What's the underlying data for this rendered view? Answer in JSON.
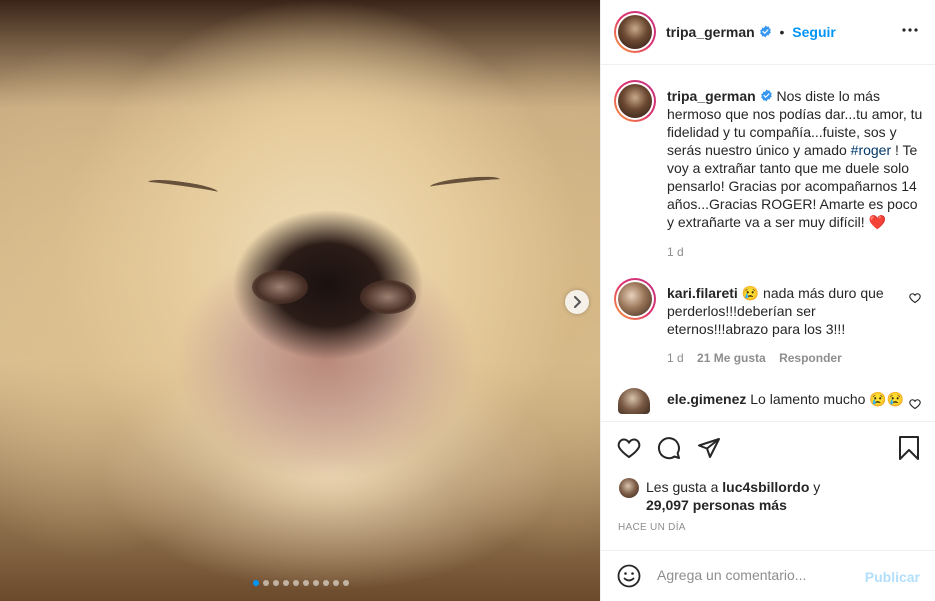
{
  "post": {
    "username": "tripa_german",
    "follow_label": "Seguir",
    "caption_pre": "Nos diste lo más hermoso que nos podías dar...tu amor, tu fidelidad y tu compañía...fuiste, sos y serás nuestro único y amado ",
    "caption_hashtag": "#roger",
    "caption_post": " ! Te voy a extrañar tanto que me duele solo pensarlo! Gracias por acompañarnos 14 años...Gracias ROGER! Amarte es poco y extrañarte va a ser muy difícil! ",
    "caption_emoji": "❤️",
    "caption_time": "1 d"
  },
  "carousel": {
    "slide_count": 10,
    "active_index": 0,
    "active_color": "#0095f6"
  },
  "comments": [
    {
      "username": "kari.filareti",
      "text": "😢 nada más duro que perderlos!!!deberían ser eternos!!!abrazo para los 3!!!",
      "time": "1 d",
      "likes": "21 Me gusta",
      "reply_label": "Responder"
    },
    {
      "username": "ele.gimenez",
      "text": "Lo lamento mucho 😢😢"
    }
  ],
  "actions": {
    "icons": [
      "heart-icon",
      "comment-icon",
      "share-icon",
      "bookmark-icon"
    ]
  },
  "likes": {
    "prefix": "Les gusta a ",
    "user": "luc4sbillordo",
    "suffix": " y",
    "count": "29,097 personas más"
  },
  "time_ago": "HACE UN DÍA",
  "comment_box": {
    "placeholder": "Agrega un comentario...",
    "publish_label": "Publicar",
    "emoji_icon": "smiley-icon"
  },
  "colors": {
    "link": "#0095f6",
    "hashtag": "#00376b",
    "muted": "#8e8e8e",
    "verified": "#3897f0",
    "heart_red": "#ed4956"
  }
}
